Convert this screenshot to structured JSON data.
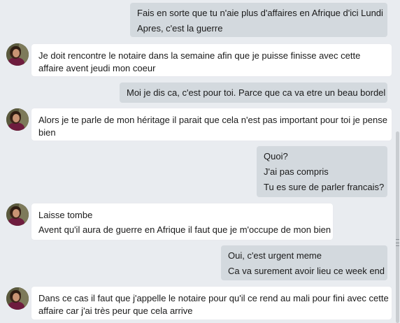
{
  "messages": [
    {
      "dir": "out",
      "lines": [
        "Fais en sorte que tu n'aie plus d'affaires en Afrique d'ici Lundi",
        "Apres, c'est la guerre"
      ]
    },
    {
      "dir": "in",
      "lines": [
        "Je doit rencontre le notaire dans la semaine afin que je puisse finisse avec cette",
        "affaire avent jeudi mon coeur"
      ]
    },
    {
      "dir": "out",
      "lines": [
        "Moi je dis ca, c'est pour toi. Parce que ca va etre un beau bordel"
      ]
    },
    {
      "dir": "in",
      "lines": [
        "Alors je te parle de mon héritage il parait que cela n'est pas important pour toi je pense",
        "bien"
      ]
    },
    {
      "dir": "out",
      "lines": [
        "Quoi?",
        "J'ai pas compris",
        "Tu es sure de parler francais?"
      ]
    },
    {
      "dir": "in",
      "lines": [
        "Laisse tombe",
        "Avent qu'il aura de guerre en Afrique il faut que je m'occupe de mon bien"
      ]
    },
    {
      "dir": "out",
      "lines": [
        "Oui, c'est urgent meme",
        "Ca va surement avoir lieu ce week end"
      ]
    },
    {
      "dir": "in",
      "lines": [
        "Dans ce cas il faut que j'appelle le notaire pour qu'il ce rend au mali pour fini avec cette",
        "affaire car j'ai très peur que cela arrive"
      ]
    }
  ],
  "icons": {
    "avatar": "contact-avatar",
    "scrollbar": "vertical-scrollbar"
  },
  "colors": {
    "background": "#e9ecf0",
    "outgoing_bubble": "#d3d9de",
    "incoming_bubble": "#ffffff"
  }
}
